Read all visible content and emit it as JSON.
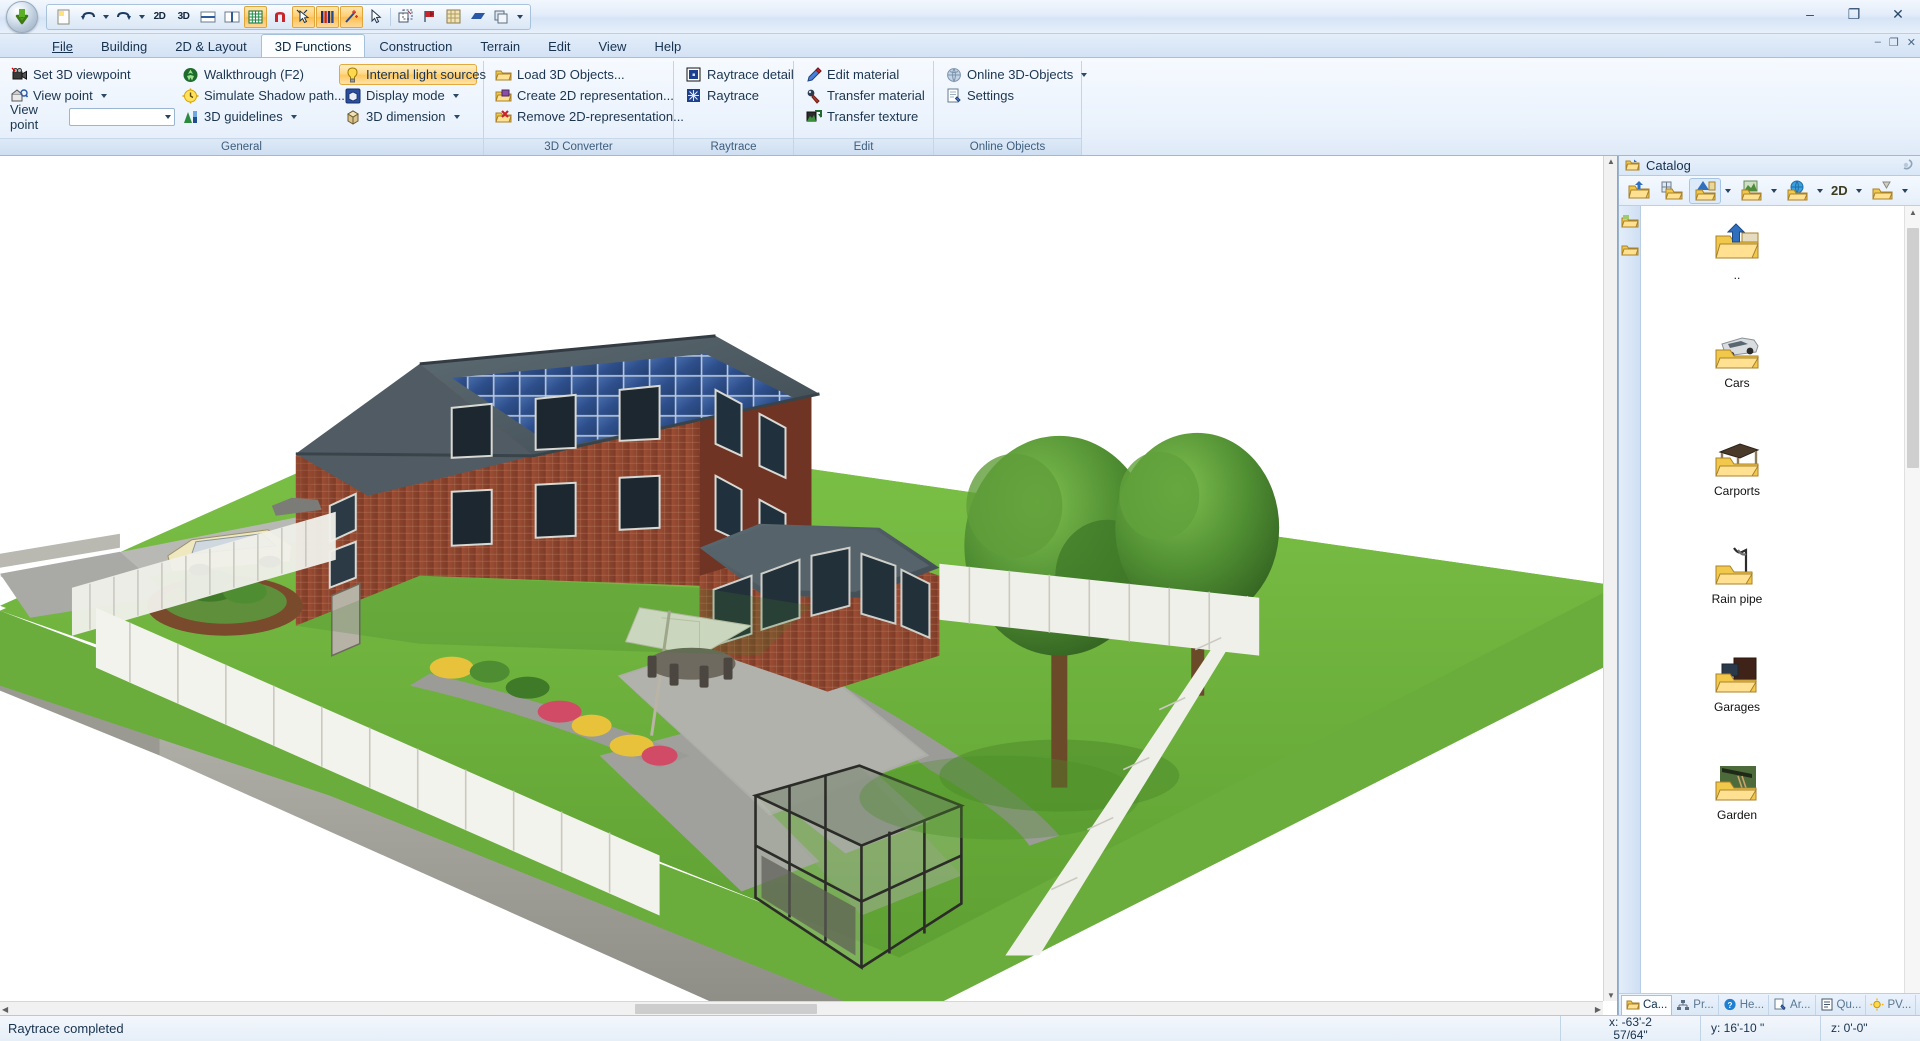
{
  "window": {
    "minimize": "–",
    "maximize": "❐",
    "close": "✕",
    "ribbon_minimize": "–",
    "ribbon_restore": "❐",
    "ribbon_close": "✕"
  },
  "quick_access": {
    "items": [
      {
        "name": "new-document-icon",
        "label": ""
      },
      {
        "name": "undo-icon",
        "label": ""
      },
      {
        "name": "undo-dropdown-icon",
        "label": ""
      },
      {
        "name": "redo-icon",
        "label": ""
      },
      {
        "name": "redo-dropdown-icon",
        "label": ""
      },
      {
        "name": "2d-view-icon",
        "label": "2D"
      },
      {
        "name": "3d-view-icon",
        "label": "3D"
      },
      {
        "name": "horizontal-split-icon",
        "label": ""
      },
      {
        "name": "vertical-split-icon",
        "label": ""
      },
      {
        "name": "grid-icon",
        "label": ""
      },
      {
        "name": "snap-magnet-icon",
        "label": ""
      },
      {
        "name": "select-pointer-icon",
        "label": ""
      },
      {
        "name": "layers-icon",
        "label": ""
      },
      {
        "name": "wand-icon",
        "label": ""
      },
      {
        "name": "arrow-pointer-icon",
        "label": ""
      },
      {
        "name": "copy-object-icon",
        "label": ""
      },
      {
        "name": "flag-icon",
        "label": ""
      },
      {
        "name": "pattern-icon",
        "label": ""
      },
      {
        "name": "blue-shape-icon",
        "label": ""
      },
      {
        "name": "duplicate-icon",
        "label": ""
      },
      {
        "name": "qat-dropdown-icon",
        "label": ""
      }
    ]
  },
  "menu_tabs": [
    {
      "label": "File",
      "accel": "F",
      "active": false
    },
    {
      "label": "Building",
      "accel": "B",
      "active": false
    },
    {
      "label": "2D & Layout",
      "accel": "",
      "active": false
    },
    {
      "label": "3D Functions",
      "accel": "",
      "active": true
    },
    {
      "label": "Construction",
      "accel": "",
      "active": false
    },
    {
      "label": "Terrain",
      "accel": "",
      "active": false
    },
    {
      "label": "Edit",
      "accel": "",
      "active": false
    },
    {
      "label": "View",
      "accel": "",
      "active": false
    },
    {
      "label": "Help",
      "accel": "",
      "active": false
    }
  ],
  "ribbon": {
    "groups": [
      {
        "title": "General",
        "columns": [
          {
            "items": [
              {
                "label": "Set 3D viewpoint",
                "icon": "camera-icon",
                "dropdown": false,
                "highlight": false
              },
              {
                "label": "View point",
                "icon": "viewpoint-icon",
                "dropdown": true,
                "highlight": false
              }
            ],
            "combo": {
              "label": "View point",
              "value": "",
              "placeholder": ""
            }
          },
          {
            "items": [
              {
                "label": "Walkthrough (F2)",
                "icon": "walk-icon",
                "dropdown": false,
                "highlight": false
              },
              {
                "label": "Simulate Shadow path...",
                "icon": "sun-clock-icon",
                "dropdown": false,
                "highlight": false
              },
              {
                "label": "3D guidelines",
                "icon": "guidelines-icon",
                "dropdown": true,
                "highlight": false
              }
            ]
          },
          {
            "items": [
              {
                "label": "Internal light sources",
                "icon": "lightbulb-icon",
                "dropdown": false,
                "highlight": true
              },
              {
                "label": "Display mode",
                "icon": "display-cube-icon",
                "dropdown": true,
                "highlight": false
              },
              {
                "label": "3D dimension",
                "icon": "dimension-cube-icon",
                "dropdown": true,
                "highlight": false
              }
            ]
          }
        ]
      },
      {
        "title": "3D Converter",
        "columns": [
          {
            "items": [
              {
                "label": "Load 3D Objects...",
                "icon": "load-folder-icon",
                "dropdown": false,
                "highlight": false
              },
              {
                "label": "Create 2D representation...",
                "icon": "create-2d-icon",
                "dropdown": false,
                "highlight": false
              },
              {
                "label": "Remove 2D-representation...",
                "icon": "remove-2d-icon",
                "dropdown": false,
                "highlight": false
              }
            ]
          }
        ]
      },
      {
        "title": "Raytrace",
        "columns": [
          {
            "items": [
              {
                "label": "Raytrace detail",
                "icon": "raytrace-detail-icon",
                "dropdown": false,
                "highlight": false
              },
              {
                "label": "Raytrace",
                "icon": "raytrace-icon",
                "dropdown": false,
                "highlight": false
              }
            ]
          }
        ]
      },
      {
        "title": "Edit",
        "columns": [
          {
            "items": [
              {
                "label": "Edit material",
                "icon": "edit-material-icon",
                "dropdown": false,
                "highlight": false
              },
              {
                "label": "Transfer material",
                "icon": "transfer-material-icon",
                "dropdown": false,
                "highlight": false
              },
              {
                "label": "Transfer texture",
                "icon": "transfer-texture-icon",
                "dropdown": false,
                "highlight": false
              }
            ]
          }
        ]
      },
      {
        "title": "Online Objects",
        "columns": [
          {
            "items": [
              {
                "label": "Online 3D-Objects",
                "icon": "globe-icon",
                "dropdown": true,
                "highlight": false
              },
              {
                "label": "Settings",
                "icon": "settings-page-icon",
                "dropdown": false,
                "highlight": false
              }
            ]
          }
        ]
      }
    ]
  },
  "catalog": {
    "title": "Catalog",
    "toolbar": [
      {
        "name": "catalog-up-folder-button",
        "label": "",
        "selected": false,
        "caret": false
      },
      {
        "name": "catalog-window-folder-button",
        "label": "",
        "selected": false,
        "caret": false
      },
      {
        "name": "catalog-3d-objects-button",
        "label": "",
        "selected": true,
        "caret": true
      },
      {
        "name": "catalog-texture-button",
        "label": "",
        "selected": false,
        "caret": true
      },
      {
        "name": "catalog-material-button",
        "label": "",
        "selected": false,
        "caret": true
      },
      {
        "name": "catalog-2d-button",
        "label": "2D",
        "selected": false,
        "caret": true
      },
      {
        "name": "catalog-misc-button",
        "label": "",
        "selected": false,
        "caret": true
      }
    ],
    "rail": [
      {
        "name": "catalog-rail-favorites-icon"
      },
      {
        "name": "catalog-rail-recent-icon"
      }
    ],
    "items": [
      {
        "label": "..",
        "thumb": "parent-folder-icon"
      },
      {
        "label": "Cars",
        "thumb": "cars-folder-icon"
      },
      {
        "label": "Carports",
        "thumb": "carports-folder-icon"
      },
      {
        "label": "Rain pipe",
        "thumb": "rainpipe-folder-icon"
      },
      {
        "label": "Garages",
        "thumb": "garages-folder-icon"
      },
      {
        "label": "Garden",
        "thumb": "garden-folder-icon"
      }
    ],
    "bottom_tabs": [
      {
        "label": "Ca...",
        "icon": "catalog-tab-icon",
        "active": true
      },
      {
        "label": "Pr...",
        "icon": "project-tab-icon",
        "active": false
      },
      {
        "label": "He...",
        "icon": "help-tab-icon",
        "active": false
      },
      {
        "label": "Ar...",
        "icon": "archive-tab-icon",
        "active": false
      },
      {
        "label": "Qu...",
        "icon": "quantity-tab-icon",
        "active": false
      },
      {
        "label": "PV...",
        "icon": "pv-tab-icon",
        "active": false
      }
    ]
  },
  "status_bar": {
    "message": "Raytrace completed",
    "coord_x": "x: -63'-2 57/64\"",
    "coord_x_line1": "x: -63'-2",
    "coord_x_line2": "57/64\"",
    "coord_y": "y: 16'-10 \"",
    "coord_z": "z: 0'-0\""
  },
  "colors": {
    "accent_orange": "#ffc960",
    "ribbon_bg": "#eaf2fc",
    "grass": "#6db23a",
    "roof": "#4a545c",
    "brick": "#9c4b32",
    "solar": "#2f4e86"
  }
}
